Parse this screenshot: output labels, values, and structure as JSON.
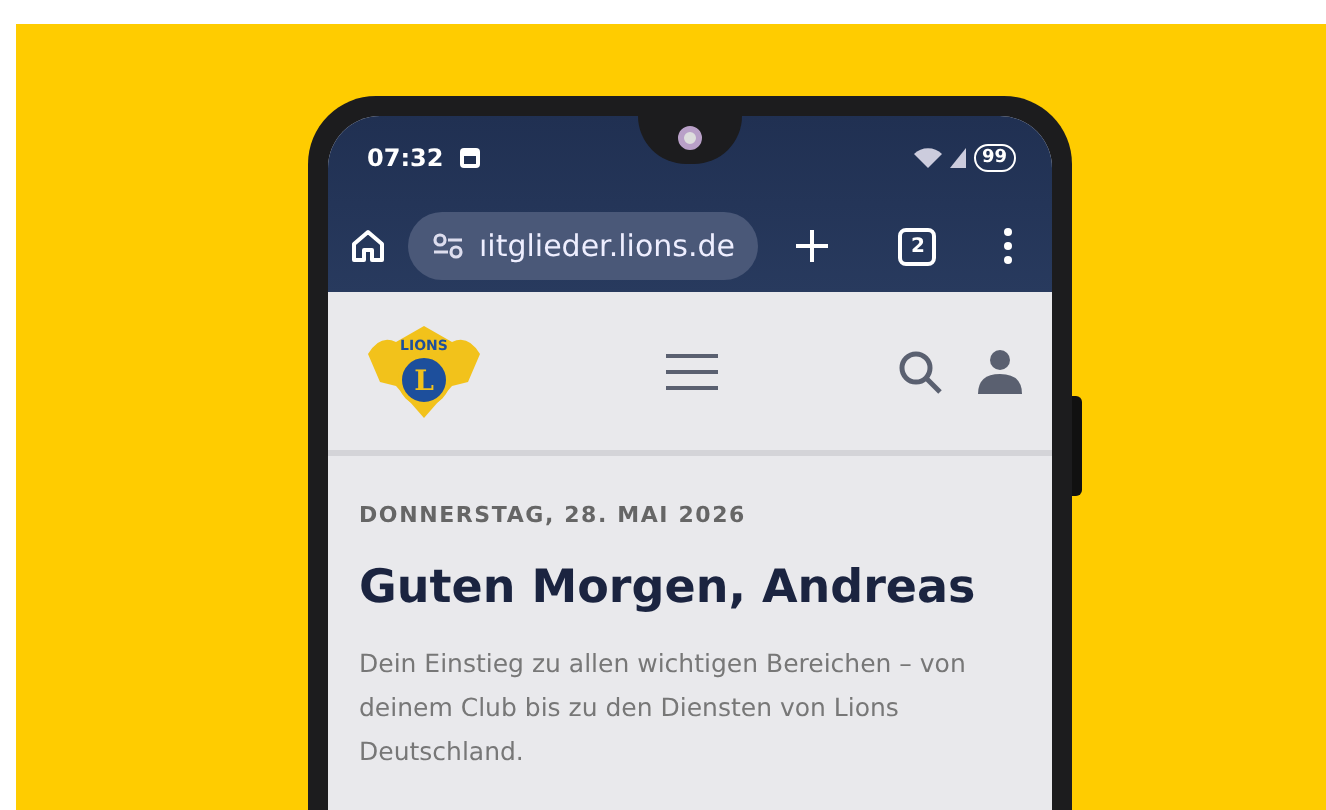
{
  "status_bar": {
    "time": "07:32",
    "battery": "99"
  },
  "browser_bar": {
    "url": "ıitglieder.lions.de",
    "tab_count": "2"
  },
  "site_header": {
    "logo": {
      "initial": "L",
      "wordmark": "LIONS"
    }
  },
  "greeting": {
    "date": "DONNERSTAG, 28. MAI 2026",
    "title": "Guten Morgen, Andreas",
    "text": "Dein Einstieg zu allen wichtigen Bereichen – von deinem Club bis zu den Diensten von Lions Deutschland."
  }
}
